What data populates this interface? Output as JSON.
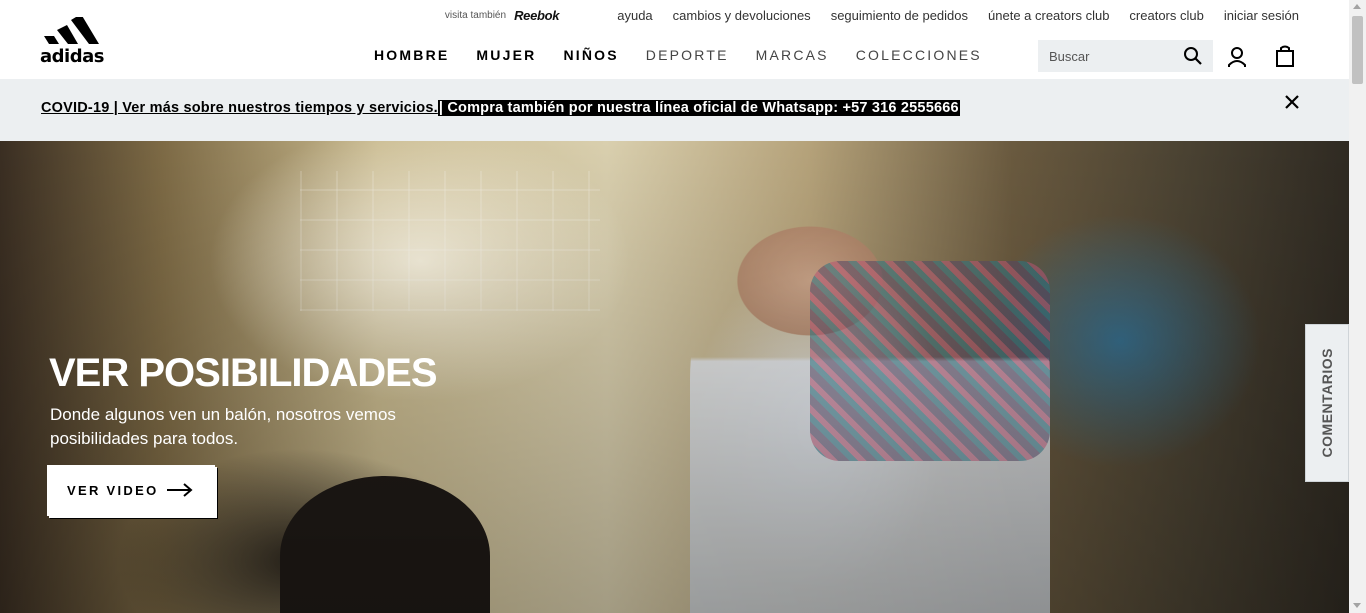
{
  "header": {
    "logo_text": "adidas",
    "visit_label": "visita también",
    "reebok_label": "Reebok",
    "util_links": [
      "ayuda",
      "cambios y devoluciones",
      "seguimiento de pedidos",
      "únete a creators club",
      "creators club",
      "iniciar sesión"
    ],
    "nav": [
      "HOMBRE",
      "MUJER",
      "NIÑOS",
      "DEPORTE",
      "MARCAS",
      "COLECCIONES"
    ],
    "search_placeholder": "Buscar"
  },
  "announcement": {
    "part1": "COVID-19 | Ver más sobre nuestros tiempos y servicios.",
    "part2": "| Compra también por nuestra línea oficial de Whatsapp: +57 316 2555666"
  },
  "hero": {
    "title": "VER POSIBILIDADES",
    "subtitle": "Donde algunos ven un balón, nosotros vemos posibilidades para todos.",
    "cta_label": "VER VIDEO"
  },
  "feedback_label": "COMENTARIOS",
  "icons": [
    "adidas-logo-icon",
    "search-icon",
    "user-icon",
    "bag-icon",
    "close-icon",
    "arrow-right-icon"
  ],
  "colors": {
    "announce_bg": "#eceff1",
    "text": "#000000",
    "hero_text": "#ffffff"
  }
}
